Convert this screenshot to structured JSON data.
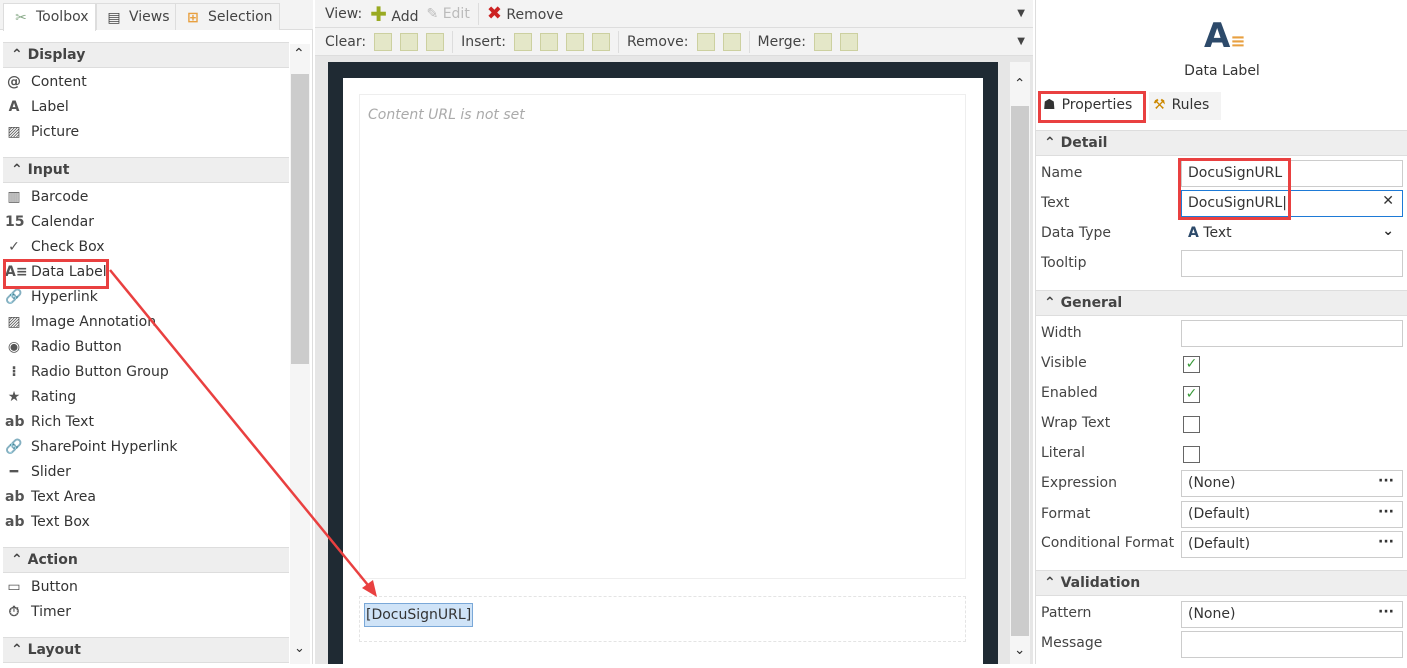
{
  "left": {
    "tabs": [
      "Toolbox",
      "Views",
      "Selection"
    ],
    "sections": [
      {
        "title": "Display",
        "items": [
          "Content",
          "Label",
          "Picture"
        ]
      },
      {
        "title": "Input",
        "items": [
          "Barcode",
          "Calendar",
          "Check Box",
          "Data Label",
          "Hyperlink",
          "Image Annotation",
          "Radio Button",
          "Radio Button Group",
          "Rating",
          "Rich Text",
          "SharePoint Hyperlink",
          "Slider",
          "Text Area",
          "Text Box"
        ]
      },
      {
        "title": "Action",
        "items": [
          "Button",
          "Timer"
        ]
      },
      {
        "title": "Layout",
        "items": []
      }
    ]
  },
  "toolbar": {
    "view": "View:",
    "add": "Add",
    "edit": "Edit",
    "remove": "Remove",
    "clear": "Clear:",
    "insert": "Insert:",
    "remove2": "Remove:",
    "merge": "Merge:"
  },
  "canvas": {
    "content_placeholder": "Content URL is not set",
    "data_label": "[DocuSignURL]"
  },
  "right": {
    "title": "Data Label",
    "tabs": [
      "Properties",
      "Rules"
    ],
    "detail": {
      "title": "Detail",
      "name_label": "Name",
      "name": "DocuSignURL",
      "text_label": "Text",
      "text": "DocuSignURL",
      "datatype_label": "Data Type",
      "datatype": "Text",
      "tooltip_label": "Tooltip"
    },
    "general": {
      "title": "General",
      "width": "Width",
      "visible": "Visible",
      "enabled": "Enabled",
      "wrap": "Wrap Text",
      "literal": "Literal",
      "expression": "Expression",
      "expression_val": "(None)",
      "format": "Format",
      "format_val": "(Default)",
      "cond": "Conditional Format",
      "cond_val": "(Default)"
    },
    "validation": {
      "title": "Validation",
      "pattern": "Pattern",
      "pattern_val": "(None)",
      "message": "Message"
    }
  },
  "colors": {
    "highlight": "#e94040",
    "accent": "#1e7ad6"
  }
}
